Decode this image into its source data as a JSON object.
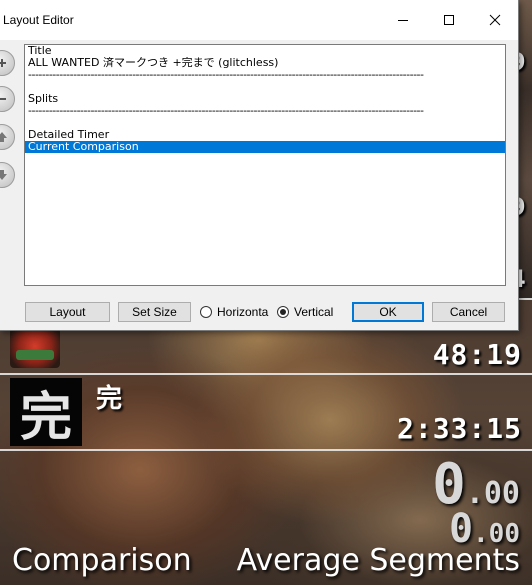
{
  "dialog": {
    "title": "Layout Editor",
    "components": [
      {
        "label": "Title",
        "detail": "ALL WANTED 済マークつき +完まで (glitchless)"
      },
      {
        "label": "Splits"
      },
      {
        "label": "Detailed Timer"
      },
      {
        "label": "Current Comparison",
        "selected": true
      }
    ],
    "divider": "------------------------------------------------------------------------------------------------------------------",
    "buttons": {
      "layout": "Layout",
      "set_size": "Set Size",
      "ok": "OK",
      "cancel": "Cancel"
    },
    "orientation": {
      "horizontal_label": "Horizonta",
      "vertical_label": "Vertical",
      "selected": "Vertical"
    },
    "side_icons": [
      "add-icon",
      "remove-icon",
      "move-up-icon",
      "move-down-icon"
    ]
  },
  "background": {
    "edge_digits": [
      "9",
      "9",
      "4"
    ],
    "segments": [
      {
        "name": "",
        "time": "48:19",
        "icon": "character-icon"
      },
      {
        "name": "完",
        "icon_char": "完",
        "time": "2:33:15"
      }
    ],
    "timer": {
      "main": "0",
      "fraction": ".00"
    },
    "segment_timer": {
      "main": "0",
      "fraction": ".00"
    },
    "comparison": {
      "label": "Comparison",
      "value": "Average Segments"
    }
  },
  "colors": {
    "selection": "#0078d7",
    "dialog_bg": "#f0f0f0",
    "timer_text": "#d8d8d8"
  }
}
